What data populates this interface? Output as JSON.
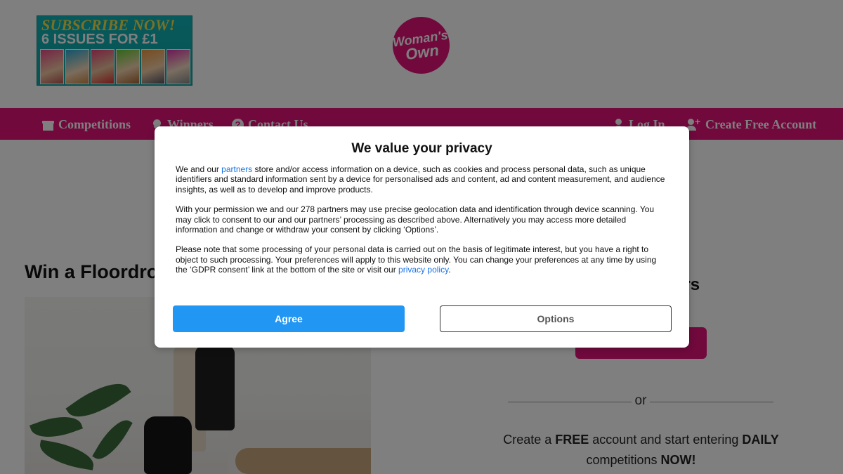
{
  "promo": {
    "line1": "SUBSCRIBE NOW!",
    "line2": "6 ISSUES FOR £1"
  },
  "brand": {
    "line1": "Woman's",
    "line2": "Own"
  },
  "nav": {
    "left": [
      {
        "label": "Competitions",
        "icon": "gift-icon"
      },
      {
        "label": "Winners",
        "icon": "map-pin-icon"
      },
      {
        "label": "Contact Us",
        "icon": "question-circle-icon"
      }
    ],
    "right": [
      {
        "label": "Log In",
        "icon": "user-icon"
      },
      {
        "label": "Create Free Account",
        "icon": "user-plus-icon"
      }
    ]
  },
  "main": {
    "competition_title": "Win a Floordro"
  },
  "sidebar": {
    "heading_partial": "ers",
    "or_text": "or",
    "free_text": {
      "part1": "Create a ",
      "bold1": "FREE",
      "part2": " account and start entering ",
      "bold2": "DAILY",
      "part3": " competitions ",
      "bold3": "NOW!"
    }
  },
  "consent": {
    "title": "We value your privacy",
    "p1_before": "We and our ",
    "p1_link": "partners",
    "p1_after": " store and/or access information on a device, such as cookies and process personal data, such as unique identifiers and standard information sent by a device for personalised ads and content, ad and content measurement, and audience insights, as well as to develop and improve products.",
    "p2": "With your permission we and our 278 partners may use precise geolocation data and identification through device scanning. You may click to consent to our and our partners’ processing as described above. Alternatively you may access more detailed information and change or withdraw your consent by clicking ‘Options’.",
    "p3_before": "Please note that some processing of your personal data is carried out on the basis of legitimate interest, but you have a right to object to such processing. Your preferences will apply to this website only. You can change your preferences at any time by using the ‘GDPR consent’ link at the bottom of the site or visit our ",
    "p3_link": "privacy policy",
    "p3_after": ".",
    "agree_label": "Agree",
    "options_label": "Options"
  },
  "colors": {
    "brand_pink": "#e2127a",
    "agree_blue": "#2196f3",
    "link_blue": "#1a73e8"
  }
}
